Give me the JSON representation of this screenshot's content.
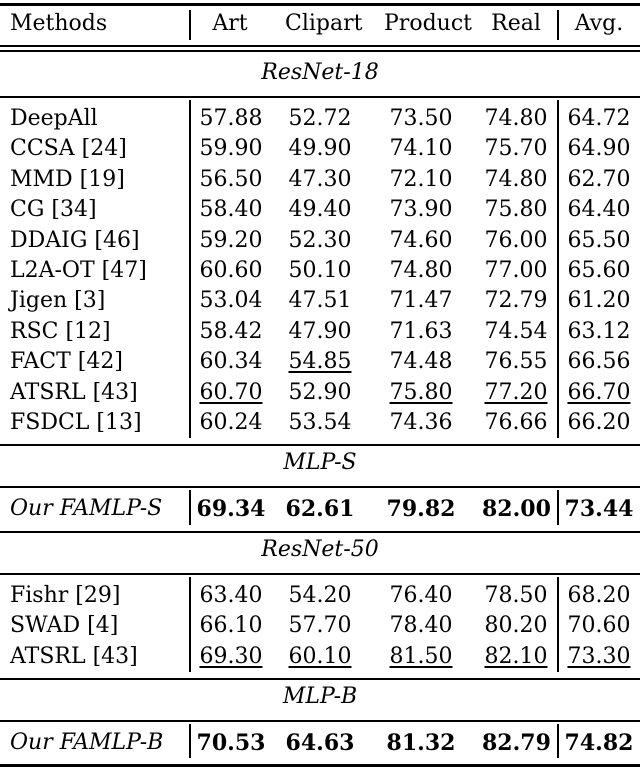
{
  "table": {
    "headers": [
      "Methods",
      "Art",
      "Clipart",
      "Product",
      "Real",
      "Avg."
    ],
    "sections": [
      {
        "title": "ResNet-18",
        "rows": [
          {
            "method": "DeepAll",
            "values": [
              "57.88",
              "52.72",
              "73.50",
              "74.80",
              "64.72"
            ],
            "underline": [
              false,
              false,
              false,
              false,
              false
            ]
          },
          {
            "method": "CCSA [24]",
            "values": [
              "59.90",
              "49.90",
              "74.10",
              "75.70",
              "64.90"
            ],
            "underline": [
              false,
              false,
              false,
              false,
              false
            ]
          },
          {
            "method": "MMD [19]",
            "values": [
              "56.50",
              "47.30",
              "72.10",
              "74.80",
              "62.70"
            ],
            "underline": [
              false,
              false,
              false,
              false,
              false
            ]
          },
          {
            "method": "CG [34]",
            "values": [
              "58.40",
              "49.40",
              "73.90",
              "75.80",
              "64.40"
            ],
            "underline": [
              false,
              false,
              false,
              false,
              false
            ]
          },
          {
            "method": "DDAIG [46]",
            "values": [
              "59.20",
              "52.30",
              "74.60",
              "76.00",
              "65.50"
            ],
            "underline": [
              false,
              false,
              false,
              false,
              false
            ]
          },
          {
            "method": "L2A-OT [47]",
            "values": [
              "60.60",
              "50.10",
              "74.80",
              "77.00",
              "65.60"
            ],
            "underline": [
              false,
              false,
              false,
              false,
              false
            ]
          },
          {
            "method": "Jigen [3]",
            "values": [
              "53.04",
              "47.51",
              "71.47",
              "72.79",
              "61.20"
            ],
            "underline": [
              false,
              false,
              false,
              false,
              false
            ]
          },
          {
            "method": "RSC [12]",
            "values": [
              "58.42",
              "47.90",
              "71.63",
              "74.54",
              "63.12"
            ],
            "underline": [
              false,
              false,
              false,
              false,
              false
            ]
          },
          {
            "method": "FACT [42]",
            "values": [
              "60.34",
              "54.85",
              "74.48",
              "76.55",
              "66.56"
            ],
            "underline": [
              false,
              true,
              false,
              false,
              false
            ]
          },
          {
            "method": "ATSRL [43]",
            "values": [
              "60.70",
              "52.90",
              "75.80",
              "77.20",
              "66.70"
            ],
            "underline": [
              true,
              false,
              true,
              true,
              true
            ]
          },
          {
            "method": "FSDCL [13]",
            "values": [
              "60.24",
              "53.54",
              "74.36",
              "76.66",
              "66.20"
            ],
            "underline": [
              false,
              false,
              false,
              false,
              false
            ]
          }
        ]
      },
      {
        "title": "MLP-S",
        "rows": [
          {
            "method": "Our FAMLP-S",
            "values": [
              "69.34",
              "62.61",
              "79.82",
              "82.00",
              "73.44"
            ],
            "bold": true
          }
        ]
      },
      {
        "title": "ResNet-50",
        "rows": [
          {
            "method": "Fishr [29]",
            "values": [
              "63.40",
              "54.20",
              "76.40",
              "78.50",
              "68.20"
            ],
            "underline": [
              false,
              false,
              false,
              false,
              false
            ]
          },
          {
            "method": "SWAD [4]",
            "values": [
              "66.10",
              "57.70",
              "78.40",
              "80.20",
              "70.60"
            ],
            "underline": [
              false,
              false,
              false,
              false,
              false
            ]
          },
          {
            "method": "ATSRL [43]",
            "values": [
              "69.30",
              "60.10",
              "81.50",
              "82.10",
              "73.30"
            ],
            "underline": [
              true,
              true,
              true,
              true,
              true
            ]
          }
        ]
      },
      {
        "title": "MLP-B",
        "rows": [
          {
            "method": "Our FAMLP-B",
            "values": [
              "70.53",
              "64.63",
              "81.32",
              "82.79",
              "74.82"
            ],
            "bold": true
          }
        ]
      }
    ]
  }
}
